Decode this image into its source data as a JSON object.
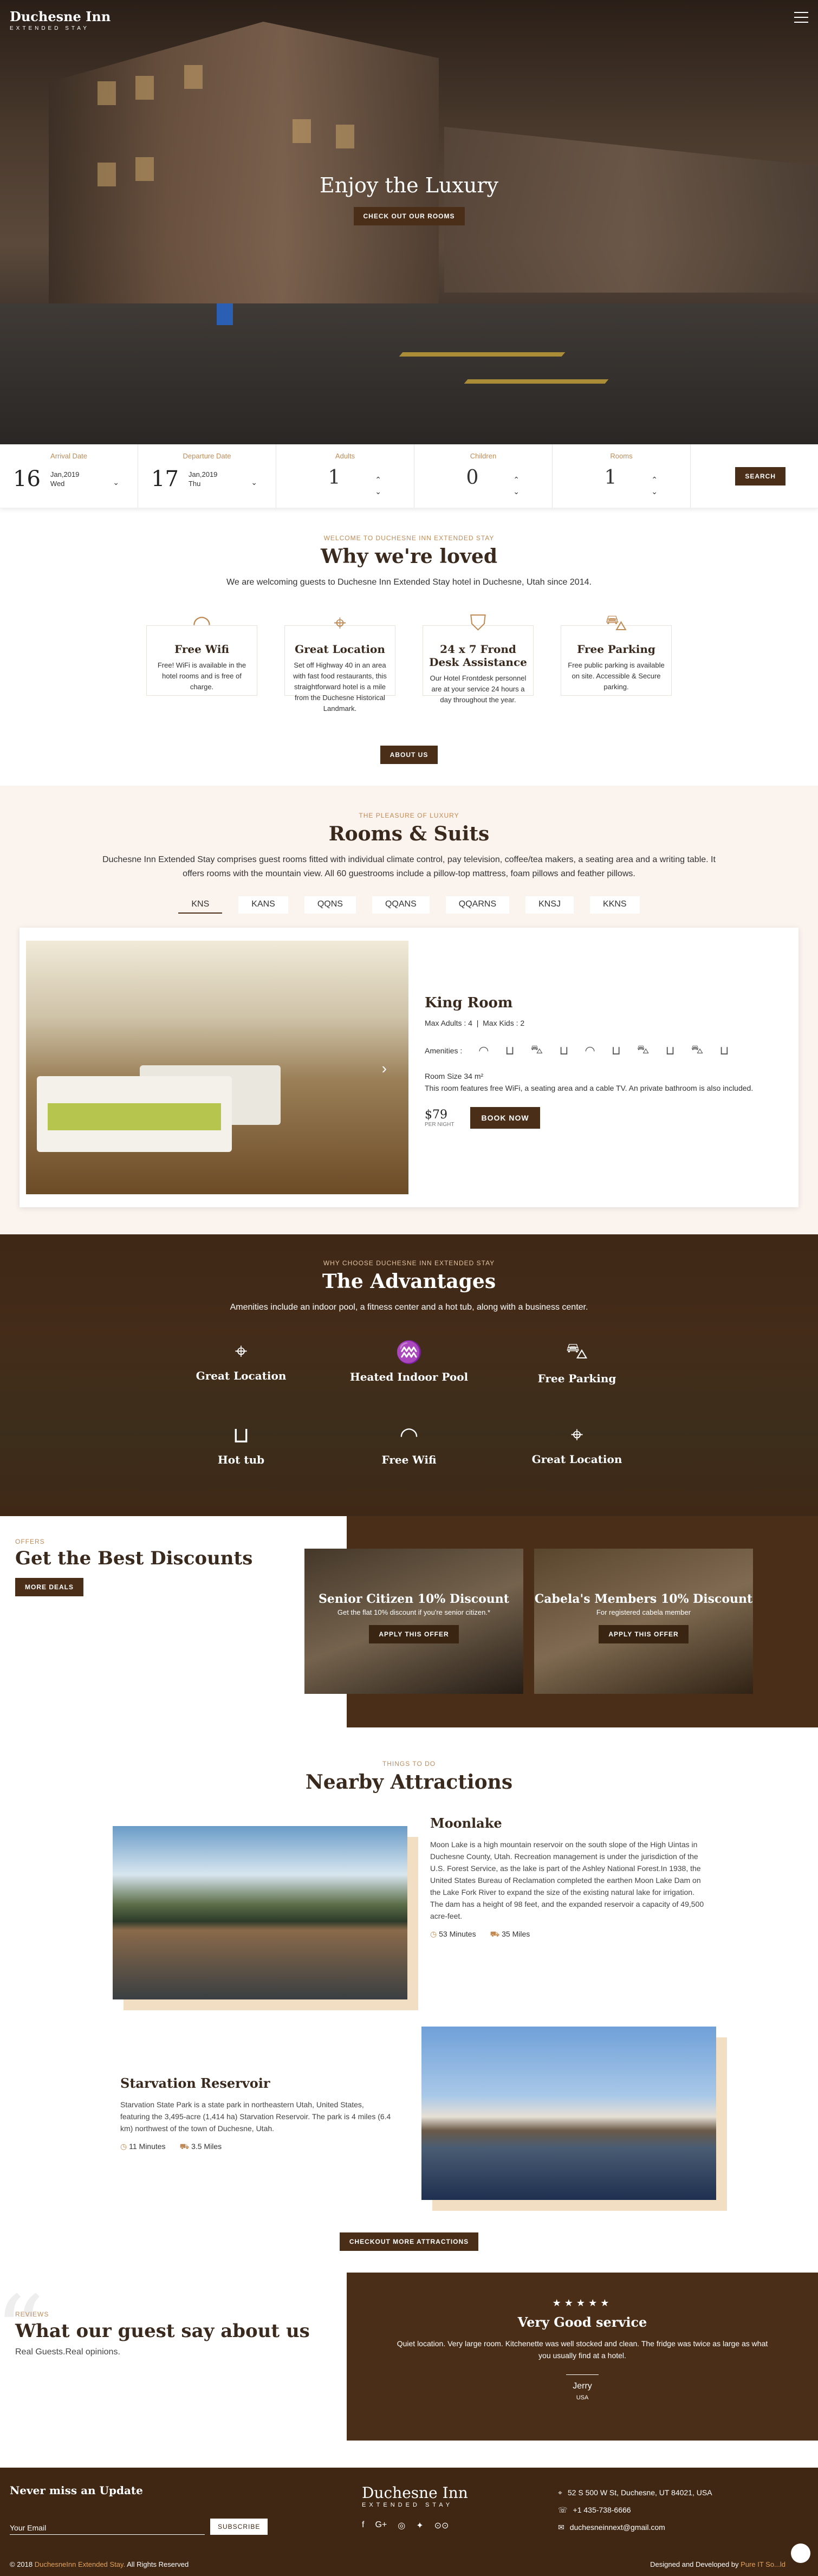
{
  "header": {
    "logo_title": "Duchesne Inn",
    "logo_subtitle": "EXTENDED STAY"
  },
  "hero": {
    "title": "Enjoy the Luxury",
    "cta": "CHECK OUT OUR ROOMS"
  },
  "booking": {
    "arrival": {
      "label": "Arrival Date",
      "day": "16",
      "month": "Jan,2019",
      "weekday": "Wed"
    },
    "departure": {
      "label": "Departure Date",
      "day": "17",
      "month": "Jan,2019",
      "weekday": "Thu"
    },
    "adults": {
      "label": "Adults",
      "value": "1"
    },
    "children": {
      "label": "Children",
      "value": "0"
    },
    "rooms": {
      "label": "Rooms",
      "value": "1"
    },
    "search": "SEARCH"
  },
  "loved": {
    "eyebrow": "WELCOME TO DUCHESNE INN EXTENDED STAY",
    "title": "Why we're loved",
    "lead": "We are welcoming guests to Duchesne Inn Extended Stay hotel in Duchesne, Utah since 2014.",
    "features": [
      {
        "title": "Free Wifi",
        "text": "Free! WiFi is available in the hotel rooms and is free of charge."
      },
      {
        "title": "Great Location",
        "text": "Set off Highway 40 in an area with fast food restaurants, this straightforward hotel is a mile from the Duchesne Historical Landmark."
      },
      {
        "title": "24 x 7 Frond Desk Assistance",
        "text": "Our Hotel Frontdesk personnel are at your service 24 hours a day throughout the year."
      },
      {
        "title": "Free Parking",
        "text": "Free public parking is available on site. Accessible & Secure parking."
      }
    ],
    "about_btn": "ABOUT US"
  },
  "rooms": {
    "eyebrow": "THE PLEASURE OF LUXURY",
    "title": "Rooms & Suits",
    "lead": "Duchesne Inn Extended Stay comprises guest rooms fitted with individual climate control, pay television, coffee/tea makers, a seating area and a writing table. It offers rooms with the mountain view. All 60 guestrooms include a pillow-top mattress, foam pillows and feather pillows.",
    "tabs": [
      "KNS",
      "KANS",
      "QQNS",
      "QQANS",
      "QQARNS",
      "KNSJ",
      "KKNS"
    ],
    "room_name": "King Room",
    "max_adults": "Max Adults : 4",
    "max_kids": "Max Kids : 2",
    "amenities_label": "Amenities :",
    "size": "Room Size 34 m²",
    "desc": "This room features free WiFi, a seating area and a cable TV. An private bathroom is also included.",
    "price": "$79",
    "per_night": "PER NIGHT",
    "book": "BOOK NOW"
  },
  "advantages": {
    "eyebrow": "WHY CHOOSE DUCHESNE INN EXTENDED STAY",
    "title": "The Advantages",
    "lead": "Amenities include an indoor pool, a fitness center and a hot tub, along with a business center.",
    "items": [
      "Great Location",
      "Heated Indoor Pool",
      "Free Parking",
      "Hot tub",
      "Free Wifi",
      "Great Location"
    ]
  },
  "offers": {
    "eyebrow": "OFFERS",
    "title": "Get the Best Discounts",
    "more": "MORE DEALS",
    "cards": [
      {
        "title": "Senior Citizen 10% Discount",
        "text": "Get the flat 10% discount if you're senior citizen.*",
        "btn": "APPLY THIS OFFER"
      },
      {
        "title": "Cabela's Members 10% Discount",
        "text": "For registered cabela member",
        "btn": "APPLY THIS OFFER"
      }
    ]
  },
  "attractions": {
    "eyebrow": "THINGS TO DO",
    "title": "Nearby Attractions",
    "items": [
      {
        "name": "Moonlake",
        "text": "Moon Lake is a high mountain reservoir on the south slope of the High Uintas in Duchesne County, Utah. Recreation management is under the jurisdiction of the U.S. Forest Service, as the lake is part of the Ashley National Forest.In 1938, the United States Bureau of Reclamation completed the earthen Moon Lake Dam on the Lake Fork River to expand the size of the existing natural lake for irrigation. The dam has a height of 98 feet, and the expanded reservoir a capacity of 49,500 acre-feet.",
        "time": "53 Minutes",
        "dist": "35 Miles"
      },
      {
        "name": "Starvation Reservoir",
        "text": "Starvation State Park is a state park in northeastern Utah, United States, featuring the 3,495-acre (1,414 ha) Starvation Reservoir. The park is 4 miles (6.4 km) northwest of the town of Duchesne, Utah.",
        "time": "11 Minutes",
        "dist": "3.5 Miles"
      }
    ],
    "more": "CHECKOUT MORE ATTRACTIONS"
  },
  "reviews": {
    "eyebrow": "REVIEWS",
    "title": "What our guest say about us",
    "sub": "Real Guests.Real opinions.",
    "stars": "★★★★★",
    "headline": "Very Good service",
    "text": "Quiet location. Very large room. Kitchenette was well stocked and clean. The fridge was twice as large as what you usually find at a hotel.",
    "name": "Jerry",
    "country": "USA"
  },
  "footer": {
    "newsletter_title": "Never miss an Update",
    "email_placeholder": "Your Email",
    "subscribe": "SUBSCRIBE",
    "logo_title": "Duchesne Inn",
    "logo_subtitle": "EXTENDED STAY",
    "address": "52 S 500 W St, Duchesne, UT 84021, USA",
    "phone": "+1 435-738-6666",
    "email": "duchesneinnext@gmail.com",
    "copy_prefix": "© 2018",
    "copy_name": "DuchesneInn Extended Stay.",
    "copy_suffix": "All Rights Reserved",
    "design_prefix": "Designed and Developed by",
    "design_name": "Pure IT So...ld"
  },
  "colors": {
    "brand_brown": "#4a2e18",
    "accent_tan": "#c08a55",
    "cream_bg": "#fbf3ee"
  }
}
